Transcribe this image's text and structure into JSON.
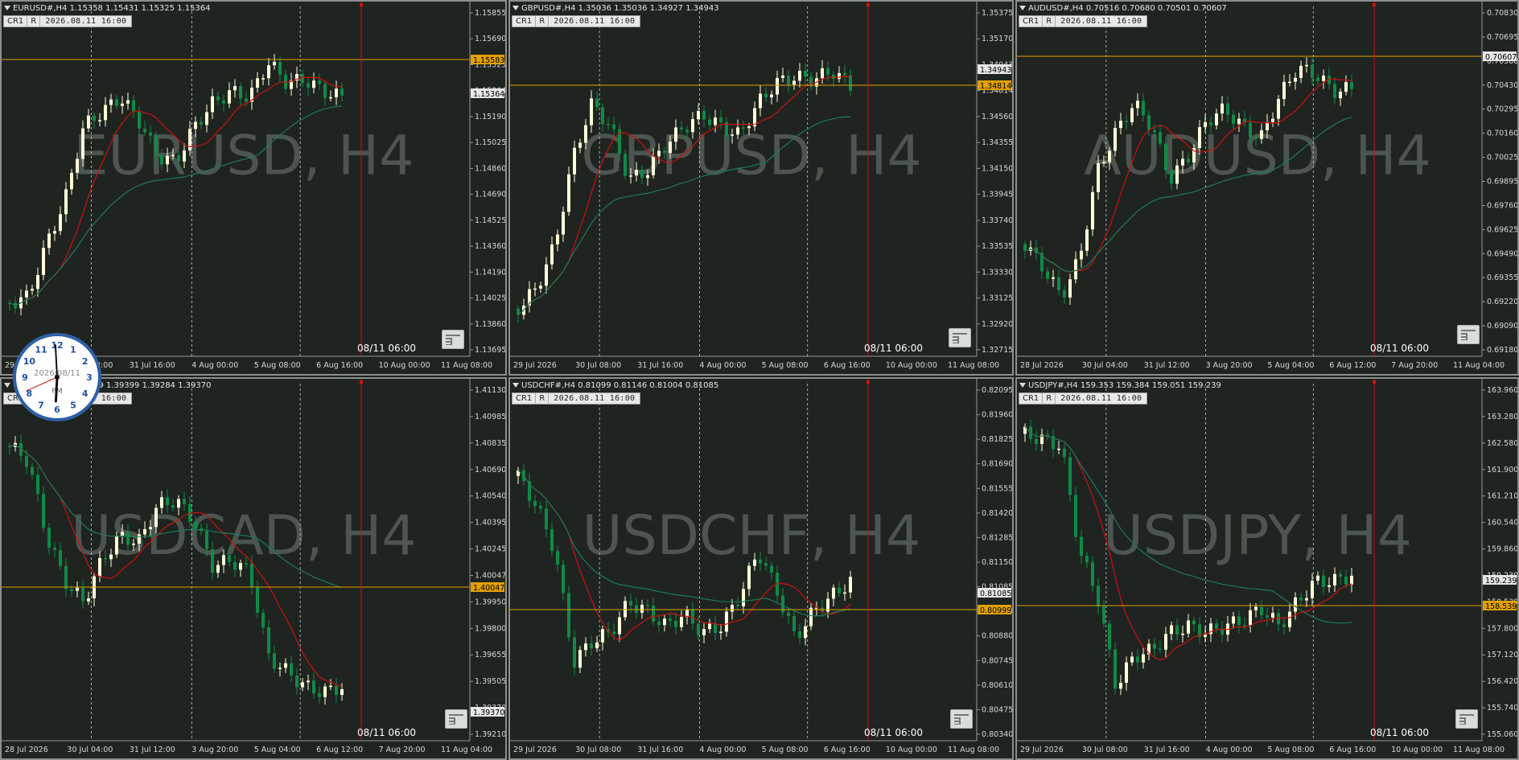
{
  "colors": {
    "bull": "#ffffd8",
    "bear": "#0f8a48",
    "ma_fast": "#d01010",
    "ma_slow": "#1f7a5a",
    "hline": "#e0a000",
    "vline": "#d01010",
    "bg": "#1f2420",
    "text": "#d8d8d8",
    "grid": "#cfcfcf"
  },
  "toolbar": {
    "cr": "CR1",
    "r": "R"
  },
  "clock": {
    "date": "2026/08/11",
    "ampm": "PM",
    "numbers": [
      "12",
      "1",
      "2",
      "3",
      "4",
      "5",
      "6",
      "7",
      "8",
      "9",
      "10",
      "11"
    ],
    "hour_hand": 6.1,
    "minute_hand": 3
  },
  "charts": [
    {
      "id": "eurusd",
      "header": "EURUSD#,H4  1.15358 1.15431 1.15325 1.15364",
      "datetime": "2026.08.11 16:00",
      "watermark": "EURUSD, H4",
      "cursor_label": "08/11 06:00",
      "prices": [
        "1.15855",
        "1.15690",
        "1.15525",
        "1.15364",
        "1.15190",
        "1.15025",
        "1.14860",
        "1.14690",
        "1.14525",
        "1.14360",
        "1.14190",
        "1.14025",
        "1.13860",
        "1.13695"
      ],
      "hline_label": "1.15583",
      "last_label": "1.15364",
      "times": [
        "29 Jul 2026",
        "30 Jul 08:00",
        "31 Jul 16:00",
        "4 Aug 00:00",
        "5 Aug 08:00",
        "6 Aug 16:00",
        "10 Aug 00:00",
        "11 Aug 08:00"
      ]
    },
    {
      "id": "gbpusd",
      "header": "GBPUSD#,H4  1.35036 1.35036 1.34927 1.34943",
      "datetime": "2026.08.11 16:00",
      "watermark": "GBPUSD, H4",
      "cursor_label": "08/11 06:00",
      "prices": [
        "1.35375",
        "1.35170",
        "1.34943",
        "1.34814",
        "1.34560",
        "1.34355",
        "1.34150",
        "1.33945",
        "1.33740",
        "1.33535",
        "1.33330",
        "1.33125",
        "1.32920",
        "1.32715"
      ],
      "hline_label": "1.34814",
      "last_label": "1.34943",
      "times": [
        "29 Jul 2026",
        "30 Jul 08:00",
        "31 Jul 16:00",
        "4 Aug 00:00",
        "5 Aug 08:00",
        "6 Aug 16:00",
        "10 Aug 00:00",
        "11 Aug 08:00"
      ]
    },
    {
      "id": "audusd",
      "header": "AUDUSD#,H4  0.70516 0.70680 0.70501 0.70607",
      "datetime": "2026.08.11 16:00",
      "watermark": "AUDUSD, H4",
      "cursor_label": "08/11 06:00",
      "prices": [
        "0.70830",
        "0.70695",
        "0.70588",
        "0.70430",
        "0.70295",
        "0.70160",
        "0.70025",
        "0.69895",
        "0.69760",
        "0.69625",
        "0.69490",
        "0.69355",
        "0.69220",
        "0.69090",
        "0.69180"
      ],
      "hline_label": "0.70588",
      "last_label": "0.70607",
      "times": [
        "28 Jul 2026",
        "30 Jul 04:00",
        "31 Jul 12:00",
        "3 Aug 20:00",
        "5 Aug 04:00",
        "6 Aug 12:00",
        "7 Aug 20:00",
        "11 Aug 04:00"
      ]
    },
    {
      "id": "usdcad",
      "header": "USDCAD#,H4  1.39399 1.39399 1.39284 1.39370",
      "datetime": "2026.08.11 16:00",
      "watermark": "USDCAD, H4",
      "cursor_label": "08/11 06:00",
      "prices": [
        "1.41130",
        "1.40985",
        "1.40835",
        "1.40690",
        "1.40540",
        "1.40395",
        "1.40245",
        "1.40047",
        "1.39950",
        "1.39800",
        "1.39655",
        "1.39505",
        "1.39370",
        "1.39210"
      ],
      "hline_label": "1.40047",
      "last_label": "1.39370",
      "times": [
        "28 Jul 2026",
        "30 Jul 04:00",
        "31 Jul 12:00",
        "3 Aug 20:00",
        "5 Aug 04:00",
        "6 Aug 12:00",
        "7 Aug 20:00",
        "11 Aug 04:00"
      ]
    },
    {
      "id": "usdchf",
      "header": "USDCHF#,H4  0.81099 0.81146 0.81004 0.81085",
      "datetime": "2026.08.11 16:00",
      "watermark": "USDCHF, H4",
      "cursor_label": "08/11 06:00",
      "prices": [
        "0.82095",
        "0.81960",
        "0.81825",
        "0.81690",
        "0.81555",
        "0.81420",
        "0.81285",
        "0.81150",
        "0.81085",
        "0.80999",
        "0.80880",
        "0.80745",
        "0.80610",
        "0.80475",
        "0.80340"
      ],
      "hline_label": "0.80999",
      "last_label": "0.81085",
      "times": [
        "29 Jul 2026",
        "30 Jul 08:00",
        "31 Jul 16:00",
        "4 Aug 00:00",
        "5 Aug 08:00",
        "6 Aug 16:00",
        "10 Aug 00:00",
        "11 Aug 08:00"
      ]
    },
    {
      "id": "usdjpy",
      "header": "USDJPY#,H4  159.353 159.384 159.051 159.239",
      "datetime": "2026.08.11 16:00",
      "watermark": "USDJPY, H4",
      "cursor_label": "08/11 06:00",
      "prices": [
        "163.960",
        "163.280",
        "162.580",
        "161.900",
        "161.210",
        "160.540",
        "159.860",
        "159.239",
        "158.539",
        "157.800",
        "157.120",
        "156.420",
        "155.740",
        "155.060"
      ],
      "hline_label": "158.539",
      "last_label": "159.239",
      "times": [
        "29 Jul 2026",
        "30 Jul 08:00",
        "31 Jul 16:00",
        "4 Aug 00:00",
        "5 Aug 08:00",
        "6 Aug 16:00",
        "10 Aug 00:00",
        "11 Aug 08:00"
      ]
    }
  ]
}
